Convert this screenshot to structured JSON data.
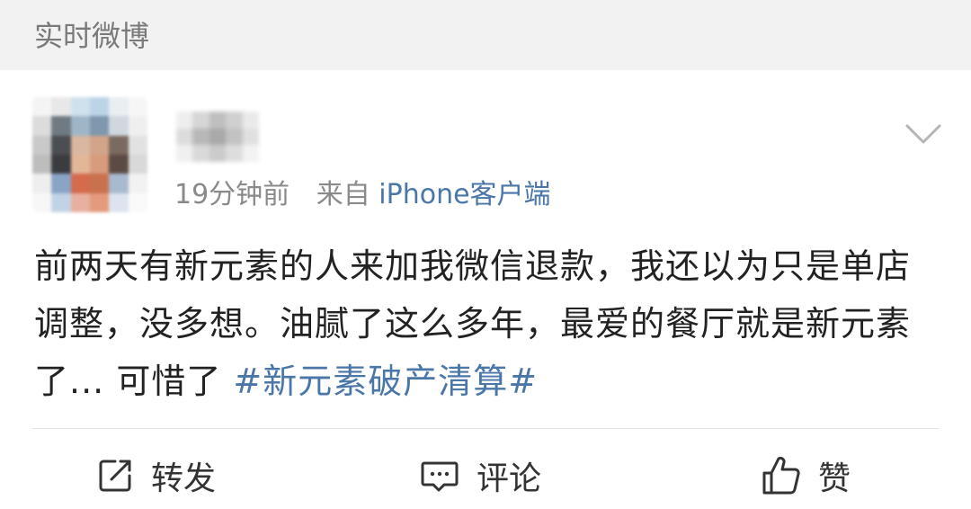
{
  "header": {
    "title": "实时微博"
  },
  "post": {
    "time": "19分钟前",
    "source_prefix": "来自",
    "source": "iPhone客户端",
    "text": "前两天有新元素的人来加我微信退款，我还以为只是单店调整，没多想。油腻了这么多年，最爱的餐厅就是新元素了... 可惜了 ",
    "hashtag": "#新元素破产清算#"
  },
  "actions": {
    "repost": "转发",
    "comment": "评论",
    "like": "赞"
  },
  "icons": {
    "repost": "share-icon",
    "comment": "comment-icon",
    "like": "thumbs-up-icon",
    "more": "chevron-down-icon"
  },
  "colors": {
    "header_bg": "#f2f2f2",
    "link": "#4a76a8",
    "text": "#222222",
    "meta": "#8a8a8a"
  }
}
